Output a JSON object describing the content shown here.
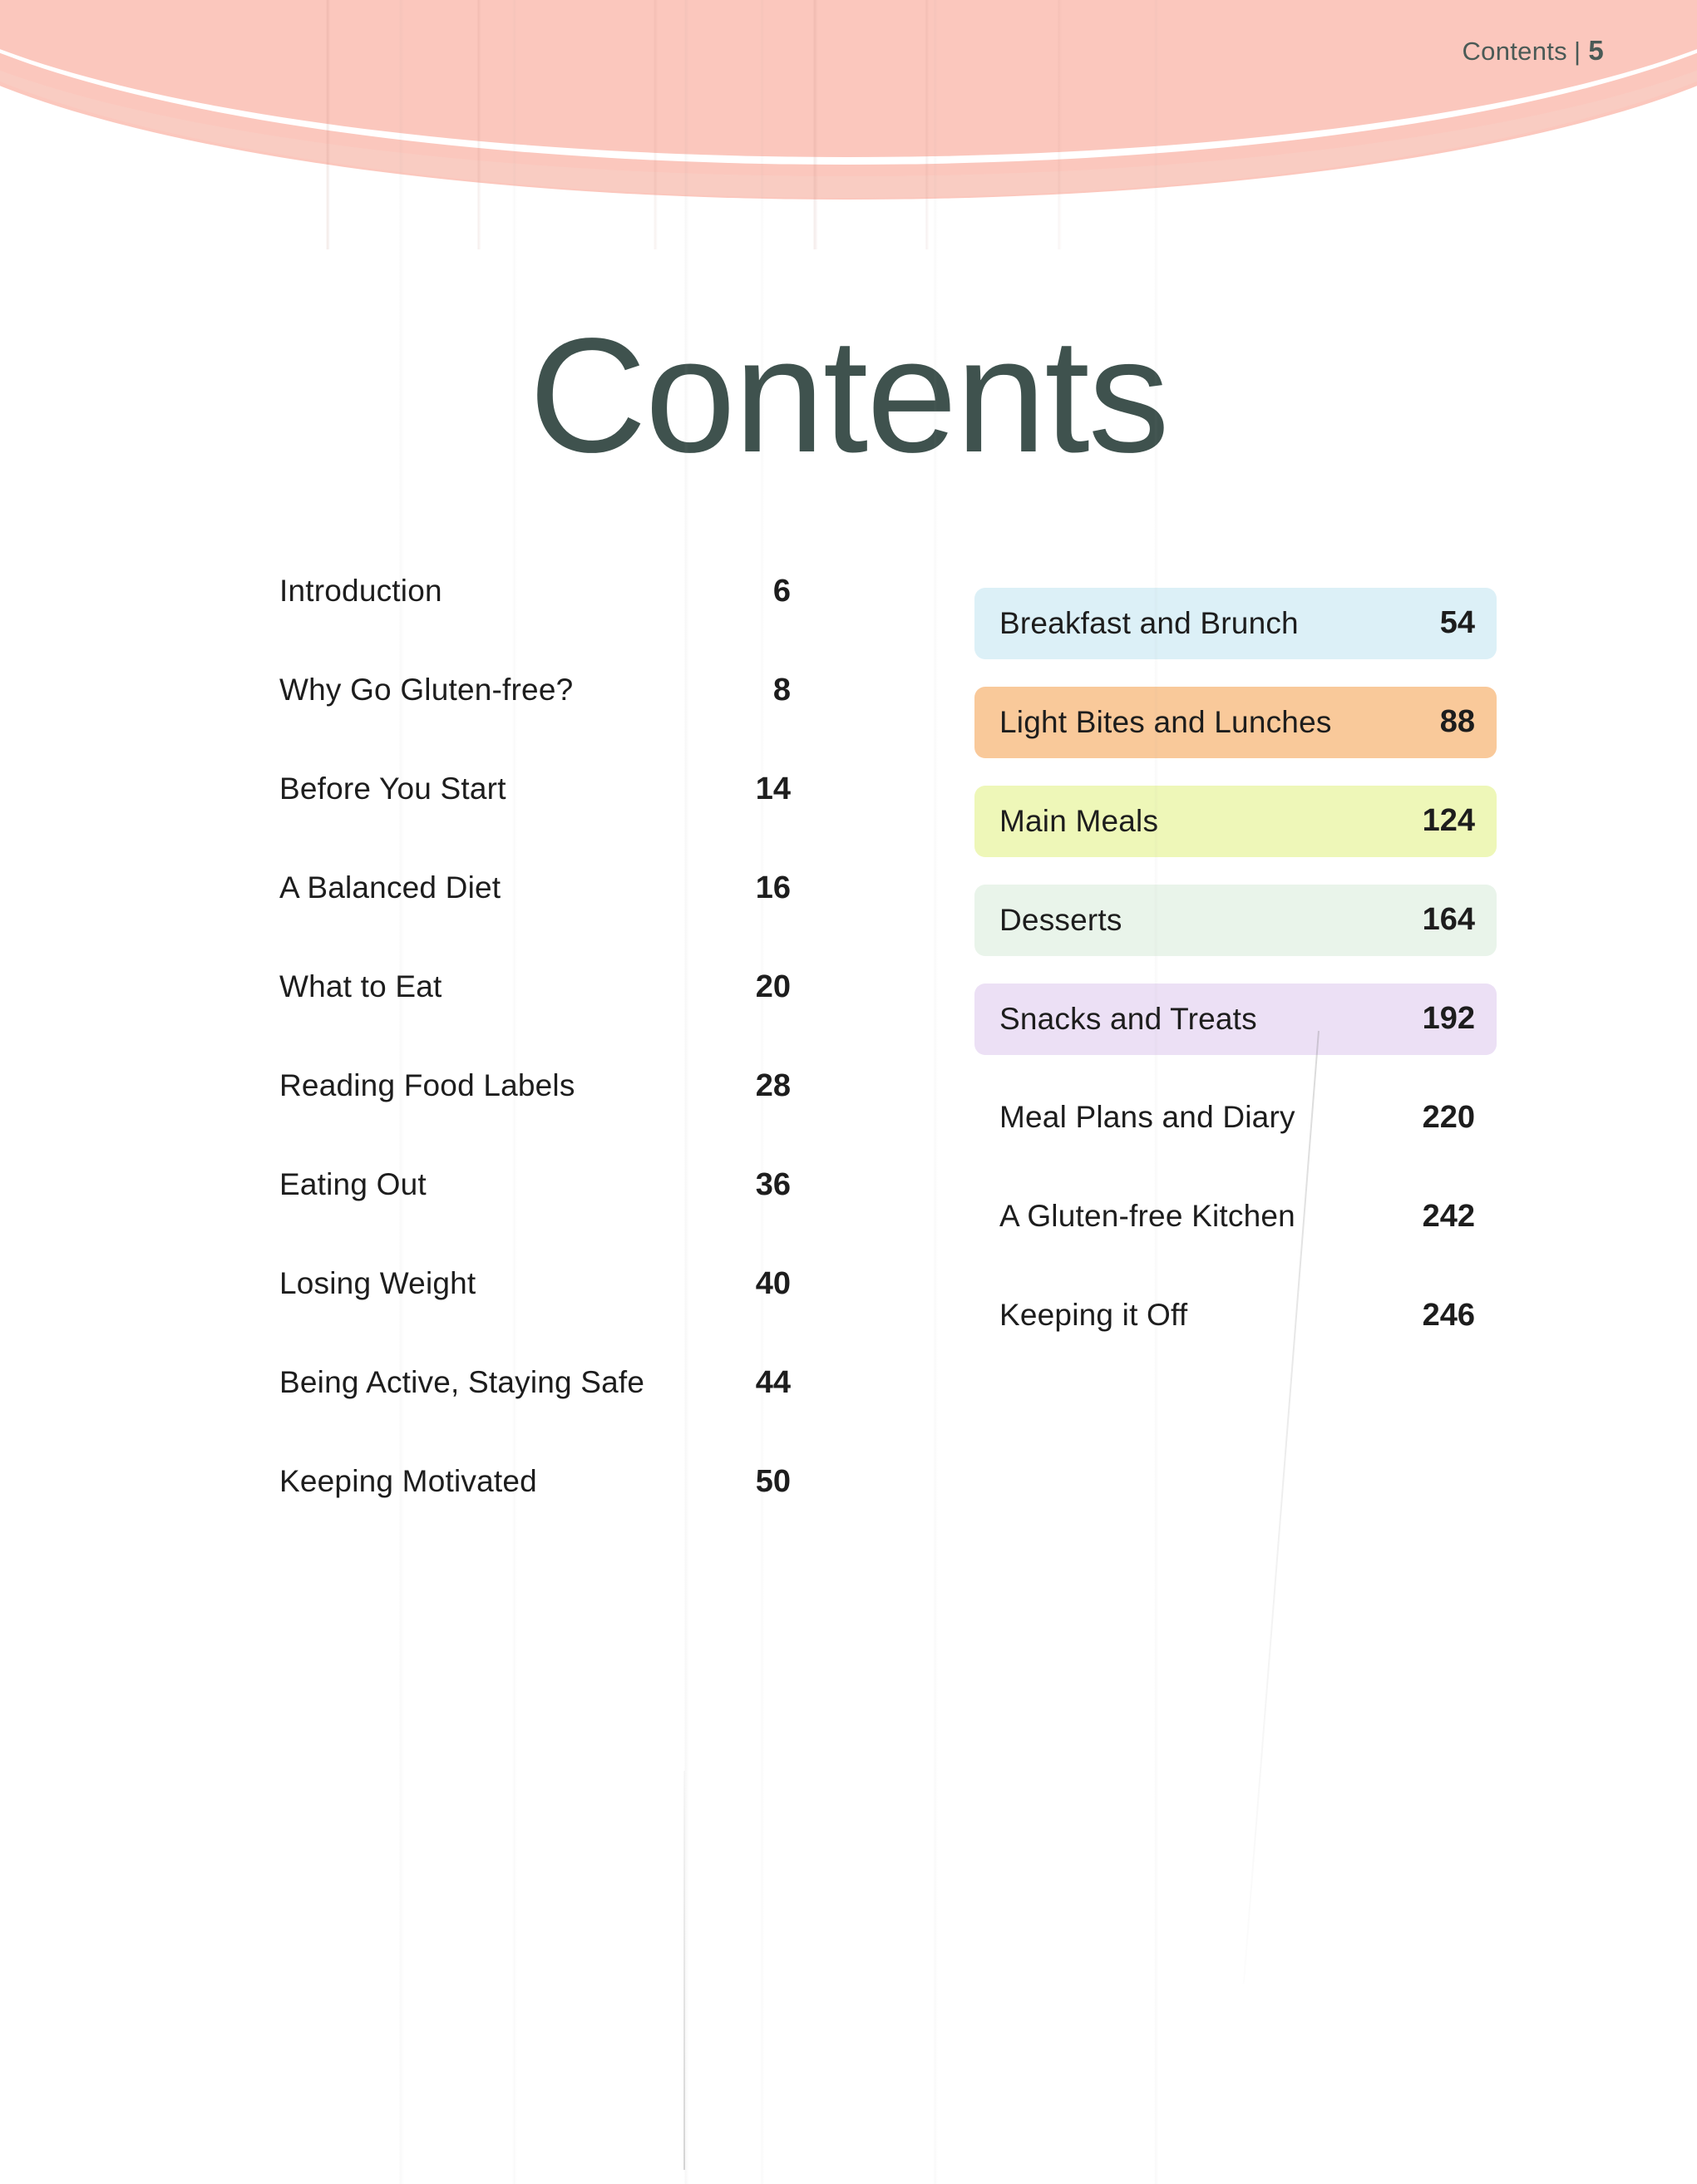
{
  "header": {
    "running_head_label": "Contents",
    "running_head_separator": "|",
    "page_number": "5"
  },
  "title": "Contents",
  "colors": {
    "banner_pink": "#fbc7bd",
    "banner_pink_light": "#f9cdc3",
    "title_text": "#3f524e",
    "body_text": "#1d1d1d",
    "pill_breakfast": "#dcf0f7",
    "pill_light_bites": "#f9c99a",
    "pill_main_meals": "#eef7b8",
    "pill_desserts": "#e9f4ea",
    "pill_snacks": "#ece0f5"
  },
  "left_column": [
    {
      "title": "Introduction",
      "page": "6"
    },
    {
      "title": "Why Go Gluten-free?",
      "page": "8"
    },
    {
      "title": "Before You Start",
      "page": "14"
    },
    {
      "title": "A Balanced Diet",
      "page": "16"
    },
    {
      "title": "What to Eat",
      "page": "20"
    },
    {
      "title": "Reading Food Labels",
      "page": "28"
    },
    {
      "title": "Eating Out",
      "page": "36"
    },
    {
      "title": "Losing Weight",
      "page": "40"
    },
    {
      "title": "Being Active, Staying Safe",
      "page": "44"
    },
    {
      "title": "Keeping Motivated",
      "page": "50"
    }
  ],
  "right_column": [
    {
      "title": "Breakfast and Brunch",
      "page": "54",
      "highlight": "#dcf0f7"
    },
    {
      "title": "Light Bites and Lunches",
      "page": "88",
      "highlight": "#f9c99a"
    },
    {
      "title": "Main Meals",
      "page": "124",
      "highlight": "#eef7b8"
    },
    {
      "title": "Desserts",
      "page": "164",
      "highlight": "#e9f4ea"
    },
    {
      "title": "Snacks and Treats",
      "page": "192",
      "highlight": "#ece0f5"
    },
    {
      "title": "Meal Plans and Diary",
      "page": "220",
      "highlight": null
    },
    {
      "title": "A Gluten-free Kitchen",
      "page": "242",
      "highlight": null
    },
    {
      "title": "Keeping it Off",
      "page": "246",
      "highlight": null
    }
  ]
}
